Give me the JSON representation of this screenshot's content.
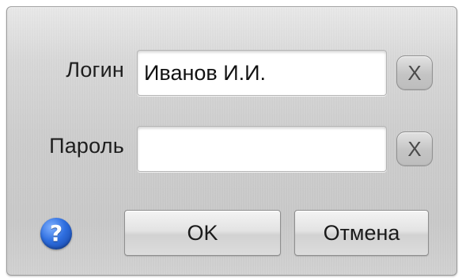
{
  "login": {
    "label": "Логин",
    "value": "Иванов И.И.",
    "clear_label": "X"
  },
  "password": {
    "label": "Пароль",
    "value": "",
    "clear_label": "X"
  },
  "footer": {
    "help_glyph": "?",
    "ok_label": "OK",
    "cancel_label": "Отмена"
  },
  "colors": {
    "help_icon": "#2f6fe0",
    "panel": "#cdcdcd"
  },
  "icons": {
    "help": "question-mark-circle-icon"
  }
}
